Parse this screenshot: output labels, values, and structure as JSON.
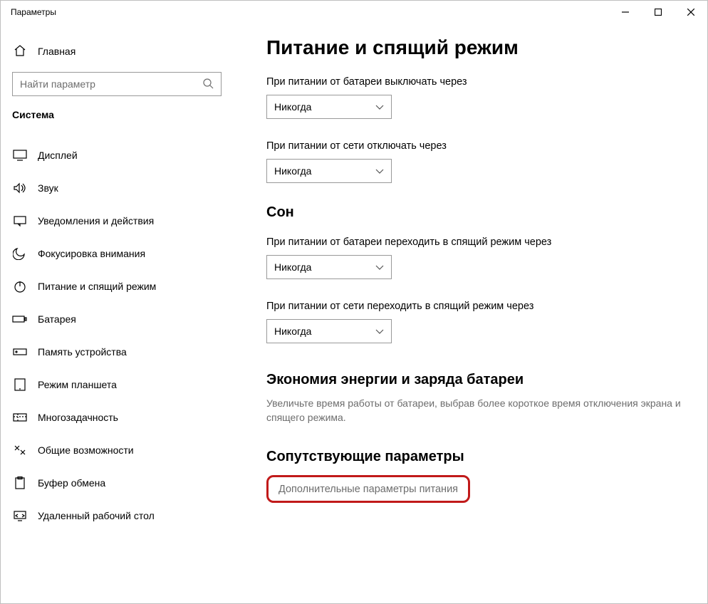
{
  "window": {
    "title": "Параметры"
  },
  "sidebar": {
    "home": "Главная",
    "search_placeholder": "Найти параметр",
    "category": "Система",
    "items": [
      {
        "id": "display",
        "label": "Дисплей"
      },
      {
        "id": "sound",
        "label": "Звук"
      },
      {
        "id": "notifications",
        "label": "Уведомления и действия"
      },
      {
        "id": "focus",
        "label": "Фокусировка внимания"
      },
      {
        "id": "power",
        "label": "Питание и спящий режим"
      },
      {
        "id": "battery",
        "label": "Батарея"
      },
      {
        "id": "storage",
        "label": "Память устройства"
      },
      {
        "id": "tablet",
        "label": "Режим планшета"
      },
      {
        "id": "multitask",
        "label": "Многозадачность"
      },
      {
        "id": "project",
        "label": "Общие возможности"
      },
      {
        "id": "clipboard",
        "label": "Буфер обмена"
      },
      {
        "id": "remote",
        "label": "Удаленный рабочий стол"
      }
    ]
  },
  "main": {
    "title": "Питание и спящий режим",
    "screen_off_battery_label": "При питании от батареи выключать через",
    "screen_off_battery_value": "Никогда",
    "screen_off_ac_label": "При питании от сети отключать через",
    "screen_off_ac_value": "Никогда",
    "sleep_heading": "Сон",
    "sleep_battery_label": "При питании от батареи переходить в спящий режим через",
    "sleep_battery_value": "Никогда",
    "sleep_ac_label": "При питании от сети переходить в спящий режим через",
    "sleep_ac_value": "Никогда",
    "energy_heading": "Экономия энергии и заряда батареи",
    "energy_hint": "Увеличьте время работы от батареи, выбрав более короткое время отключения экрана и спящего режима.",
    "related_heading": "Сопутствующие параметры",
    "related_link": "Дополнительные параметры питания"
  }
}
